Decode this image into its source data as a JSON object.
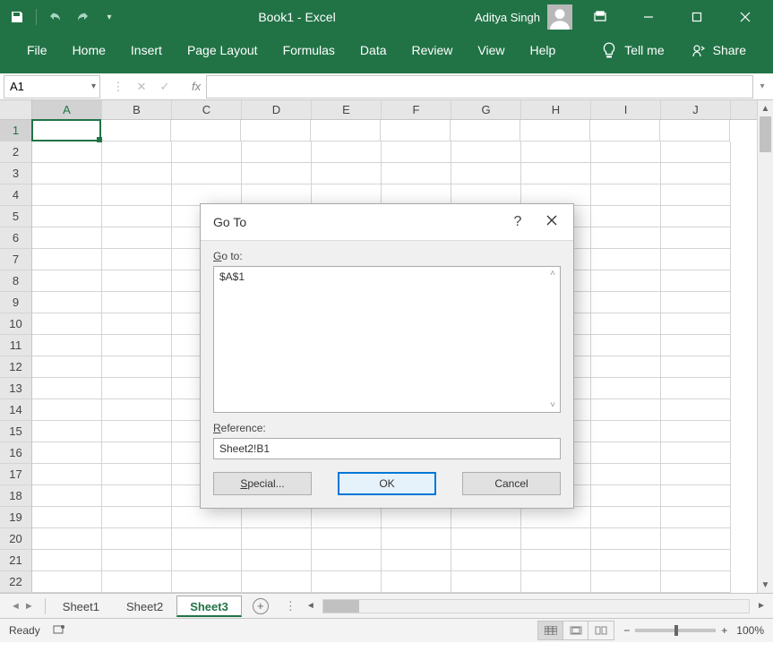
{
  "titlebar": {
    "doc_title": "Book1 ‑ Excel",
    "username": "Aditya Singh"
  },
  "ribbon": {
    "tabs": [
      "File",
      "Home",
      "Insert",
      "Page Layout",
      "Formulas",
      "Data",
      "Review",
      "View",
      "Help"
    ],
    "tellme": "Tell me",
    "share": "Share"
  },
  "formulabar": {
    "namebox": "A1",
    "fx_label": "fx"
  },
  "grid": {
    "columns": [
      "A",
      "B",
      "C",
      "D",
      "E",
      "F",
      "G",
      "H",
      "I",
      "J"
    ],
    "rows": [
      "1",
      "2",
      "3",
      "4",
      "5",
      "6",
      "7",
      "8",
      "9",
      "10",
      "11",
      "12",
      "13",
      "14",
      "15",
      "16",
      "17",
      "18",
      "19",
      "20",
      "21",
      "22"
    ],
    "active_col": "A",
    "active_row": "1"
  },
  "sheets": {
    "tabs": [
      "Sheet1",
      "Sheet2",
      "Sheet3"
    ],
    "active": "Sheet3"
  },
  "statusbar": {
    "status": "Ready",
    "zoom": "100%"
  },
  "dialog": {
    "title": "Go To",
    "goto_label": "Go to:",
    "list_item0": "$A$1",
    "reference_label": "Reference:",
    "reference_value": "Sheet2!B1",
    "special": "Special...",
    "ok": "OK",
    "cancel": "Cancel",
    "help": "?"
  }
}
